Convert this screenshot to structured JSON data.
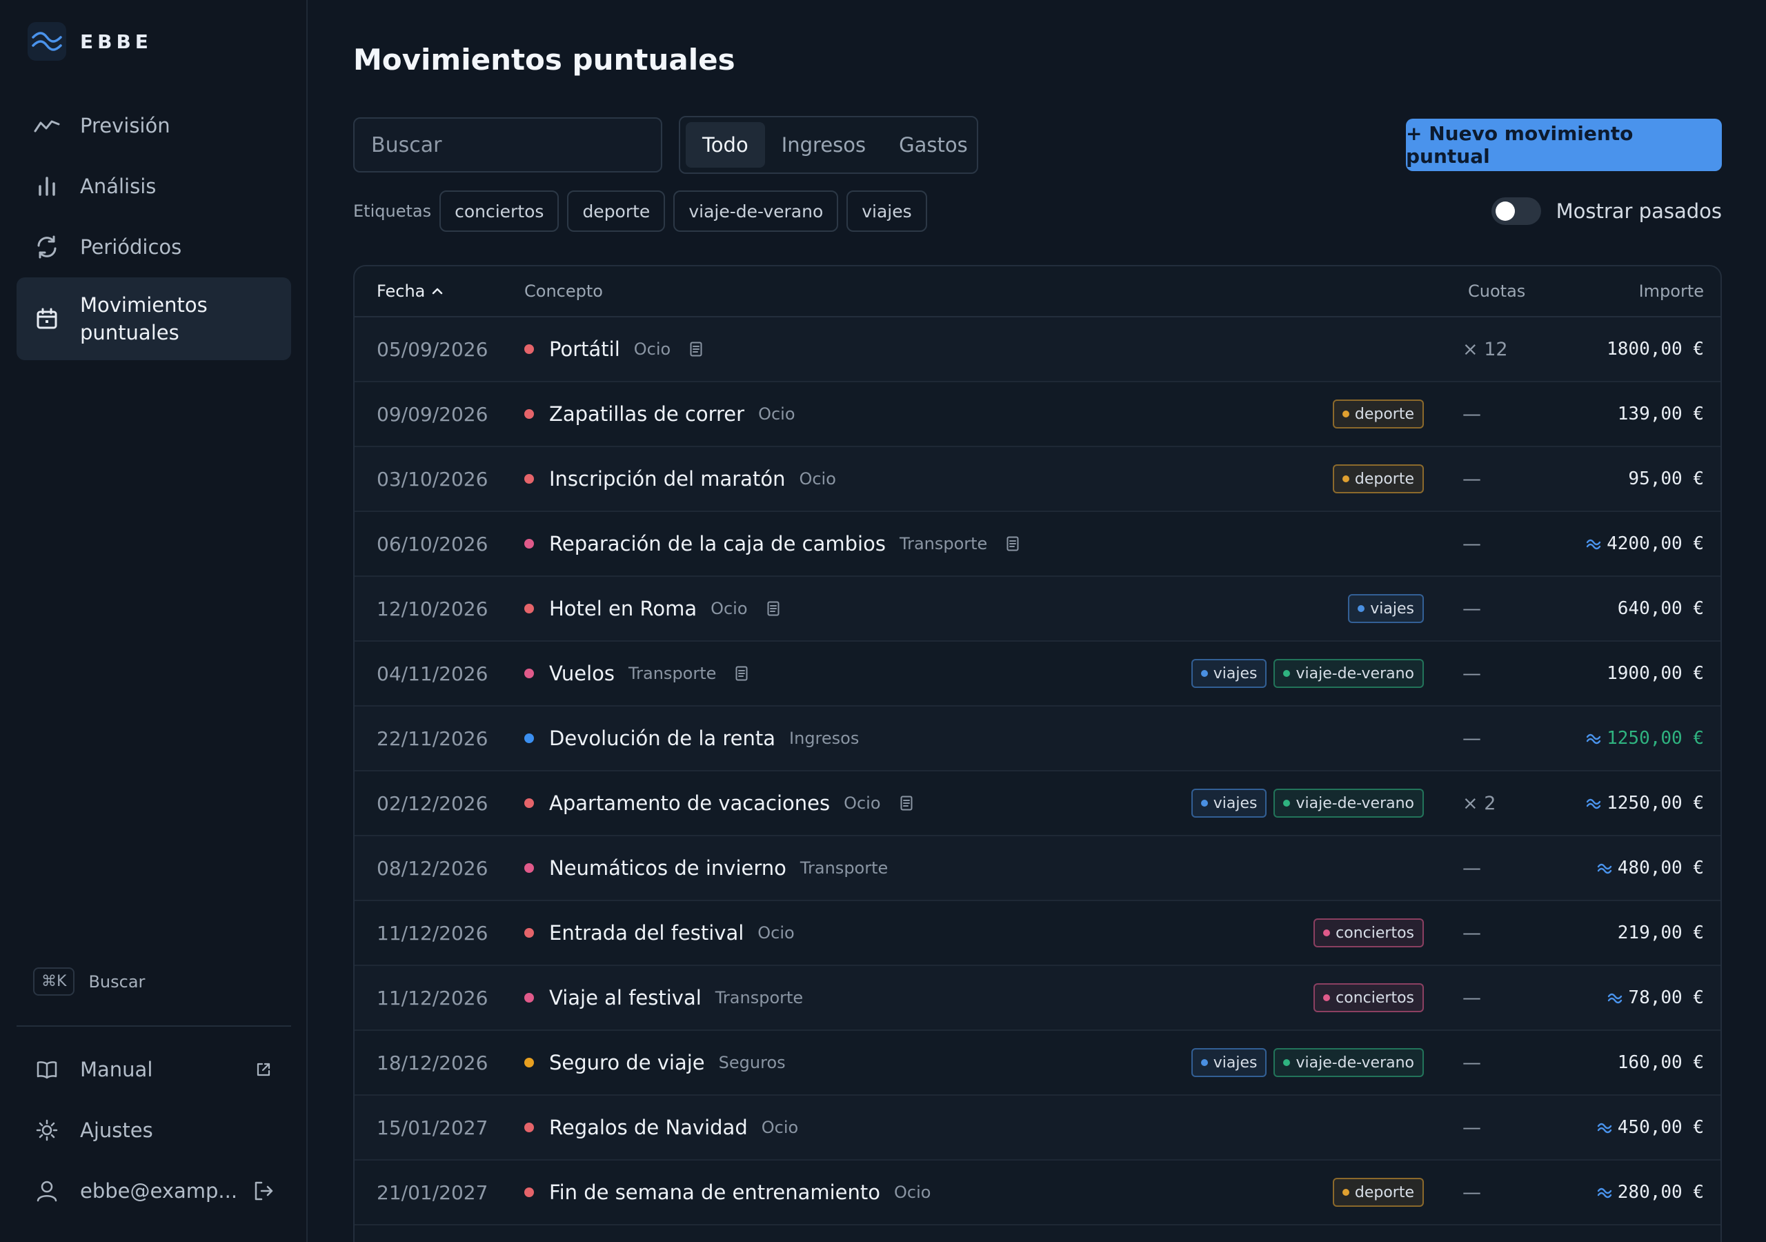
{
  "brand": {
    "name": "EBBE"
  },
  "sidebar": {
    "nav": [
      {
        "id": "prevision",
        "label": "Previsión",
        "icon": "trend-icon"
      },
      {
        "id": "analisis",
        "label": "Análisis",
        "icon": "bar-chart-icon"
      },
      {
        "id": "periodicos",
        "label": "Periódicos",
        "icon": "refresh-icon"
      },
      {
        "id": "movimientos",
        "label": "Movimientos puntuales",
        "icon": "calendar-icon"
      }
    ],
    "search_shortcut": "⌘K",
    "search_label": "Buscar",
    "manual_label": "Manual",
    "settings_label": "Ajustes",
    "user_label": "ebbe@examp..."
  },
  "main": {
    "title": "Movimientos puntuales",
    "search_placeholder": "Buscar",
    "filters": [
      "Todo",
      "Ingresos",
      "Gastos"
    ],
    "active_filter": "Todo",
    "new_button": "+ Nuevo movimiento puntual",
    "tags_label": "Etiquetas",
    "tags": [
      "conciertos",
      "deporte",
      "viaje-de-verano",
      "viajes"
    ],
    "show_past_label": "Mostrar pasados",
    "show_past": false
  },
  "table": {
    "headers": {
      "fecha": "Fecha",
      "concepto": "Concepto",
      "cuotas": "Cuotas",
      "importe": "Importe"
    },
    "rows": [
      {
        "date": "05/09/2026",
        "name": "Portátil",
        "category": "Ocio",
        "dot": "#e5646a",
        "note": true,
        "tags": [],
        "cuotas": "× 12",
        "amount": "1800,00 €",
        "approx": false,
        "income": false
      },
      {
        "date": "09/09/2026",
        "name": "Zapatillas de correr",
        "category": "Ocio",
        "dot": "#e5646a",
        "note": false,
        "tags": [
          "deporte"
        ],
        "cuotas": "—",
        "amount": "139,00 €",
        "approx": false,
        "income": false
      },
      {
        "date": "03/10/2026",
        "name": "Inscripción del maratón",
        "category": "Ocio",
        "dot": "#e5646a",
        "note": false,
        "tags": [
          "deporte"
        ],
        "cuotas": "—",
        "amount": "95,00 €",
        "approx": false,
        "income": false
      },
      {
        "date": "06/10/2026",
        "name": "Reparación de la caja de cambios",
        "category": "Transporte",
        "dot": "#e05a8a",
        "note": true,
        "tags": [],
        "cuotas": "—",
        "amount": "4200,00 €",
        "approx": true,
        "income": false
      },
      {
        "date": "12/10/2026",
        "name": "Hotel en Roma",
        "category": "Ocio",
        "dot": "#e5646a",
        "note": true,
        "tags": [
          "viajes"
        ],
        "cuotas": "—",
        "amount": "640,00 €",
        "approx": false,
        "income": false
      },
      {
        "date": "04/11/2026",
        "name": "Vuelos",
        "category": "Transporte",
        "dot": "#e05a8a",
        "note": true,
        "tags": [
          "viajes",
          "viaje-de-verano"
        ],
        "cuotas": "—",
        "amount": "1900,00 €",
        "approx": false,
        "income": false
      },
      {
        "date": "22/11/2026",
        "name": "Devolución de la renta",
        "category": "Ingresos",
        "dot": "#3b8ff0",
        "note": false,
        "tags": [],
        "cuotas": "—",
        "amount": "1250,00 €",
        "approx": true,
        "income": true
      },
      {
        "date": "02/12/2026",
        "name": "Apartamento de vacaciones",
        "category": "Ocio",
        "dot": "#e5646a",
        "note": true,
        "tags": [
          "viajes",
          "viaje-de-verano"
        ],
        "cuotas": "× 2",
        "amount": "1250,00 €",
        "approx": true,
        "income": false
      },
      {
        "date": "08/12/2026",
        "name": "Neumáticos de invierno",
        "category": "Transporte",
        "dot": "#e05a8a",
        "note": false,
        "tags": [],
        "cuotas": "—",
        "amount": "480,00 €",
        "approx": true,
        "income": false
      },
      {
        "date": "11/12/2026",
        "name": "Entrada del festival",
        "category": "Ocio",
        "dot": "#e5646a",
        "note": false,
        "tags": [
          "conciertos"
        ],
        "cuotas": "—",
        "amount": "219,00 €",
        "approx": false,
        "income": false
      },
      {
        "date": "11/12/2026",
        "name": "Viaje al festival",
        "category": "Transporte",
        "dot": "#e05a8a",
        "note": false,
        "tags": [
          "conciertos"
        ],
        "cuotas": "—",
        "amount": "78,00 €",
        "approx": true,
        "income": false
      },
      {
        "date": "18/12/2026",
        "name": "Seguro de viaje",
        "category": "Seguros",
        "dot": "#e8a020",
        "note": false,
        "tags": [
          "viajes",
          "viaje-de-verano"
        ],
        "cuotas": "—",
        "amount": "160,00 €",
        "approx": false,
        "income": false
      },
      {
        "date": "15/01/2027",
        "name": "Regalos de Navidad",
        "category": "Ocio",
        "dot": "#e5646a",
        "note": false,
        "tags": [],
        "cuotas": "—",
        "amount": "450,00 €",
        "approx": true,
        "income": false
      },
      {
        "date": "21/01/2027",
        "name": "Fin de semana de entrenamiento",
        "category": "Ocio",
        "dot": "#e5646a",
        "note": false,
        "tags": [
          "deporte"
        ],
        "cuotas": "—",
        "amount": "280,00 €",
        "approx": true,
        "income": false
      }
    ]
  },
  "colors": {
    "accent": "#4a93ec",
    "income": "#2fb380",
    "tag_deporte": "#e0a030",
    "tag_viajes": "#4a90e2",
    "tag_viaje_de_verano": "#2fb380",
    "tag_conciertos": "#e05a8a"
  }
}
